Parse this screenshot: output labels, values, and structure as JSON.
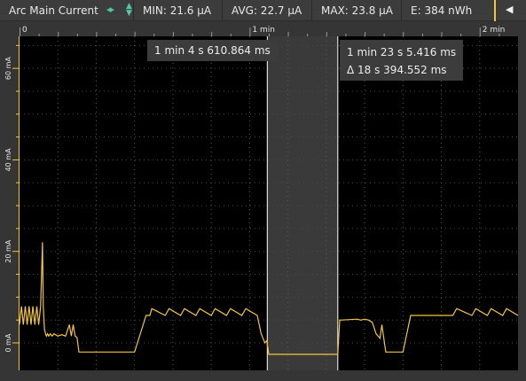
{
  "header": {
    "title": "Arc Main Current",
    "arrows_icon": "pan-arrows-icon",
    "min": "MIN: 21.6 µA",
    "avg": "AVG: 22.7 µA",
    "max": "MAX: 23.8 µA",
    "energy": "E: 384 nWh",
    "collapse_icon": "collapse-left-icon"
  },
  "selection": {
    "start_label": "1 min 4 s 610.864 ms",
    "end_label": "1 min 23 s 5.416 ms",
    "delta_label": "Δ 18 s 394.552 ms"
  },
  "colors": {
    "trace": "#f3c53a",
    "plot_bg": "#000000",
    "panel_bg": "#353535",
    "accent": "#4fc9a6"
  },
  "chart_data": {
    "type": "line",
    "x_ticks": [
      {
        "label": "0",
        "value_s": 0
      },
      {
        "label": "1 min",
        "value_s": 60
      },
      {
        "label": "2 min",
        "value_s": 120
      }
    ],
    "y_ticks": [
      {
        "label": "0 mA",
        "value_ma": 0
      },
      {
        "label": "20 mA",
        "value_ma": 20
      },
      {
        "label": "40 mA",
        "value_ma": 40
      },
      {
        "label": "60 mA",
        "value_ma": 60
      }
    ],
    "xlim_s": [
      0,
      130
    ],
    "ylim_ma": [
      -6,
      67
    ],
    "selection_s": [
      64.61,
      83.005
    ],
    "series": [
      {
        "x": [
          0,
          0.5,
          1.0,
          1.5,
          2.0,
          2.5,
          3.0,
          3.5,
          4.0,
          4.5,
          5.0,
          5.5,
          6.0,
          6.2,
          6.5,
          6.8,
          7.0,
          7.3,
          7.6,
          8.0,
          8.5,
          9.0,
          10,
          11,
          12,
          13,
          13.5,
          14,
          14.5,
          15,
          15.5,
          30,
          33,
          34,
          34.5,
          38,
          39,
          42,
          43,
          46,
          47,
          50,
          51,
          54,
          55,
          58,
          59,
          62,
          63,
          63.5,
          64,
          64.5,
          65,
          70,
          80,
          83,
          83.5,
          84,
          88,
          89,
          90,
          91,
          92,
          93,
          94,
          94.5,
          95,
          95.5,
          96,
          100,
          102,
          113,
          114,
          118,
          119,
          122,
          123,
          126,
          127,
          130
        ],
        "y_ma": [
          4,
          8,
          4,
          8,
          4,
          8,
          4,
          8,
          4,
          8,
          4,
          8,
          22,
          8,
          3,
          2,
          1.5,
          2,
          1.5,
          2,
          1.5,
          2,
          1.5,
          1.8,
          1.5,
          4,
          1.5,
          4,
          1.5,
          1.2,
          -2,
          -2,
          6,
          6,
          7.5,
          6,
          7.5,
          6,
          7.5,
          6,
          7.5,
          6,
          7.5,
          6,
          7.5,
          6,
          7.5,
          6,
          2,
          1,
          0,
          0.5,
          -2.5,
          -2.5,
          -2.5,
          -2.5,
          5,
          5,
          5.2,
          5,
          5.2,
          5,
          4.5,
          2,
          1,
          4,
          1,
          -2,
          -2,
          -2,
          6,
          6,
          7.5,
          6,
          7.5,
          6,
          7.5,
          6,
          7.5,
          6
        ]
      }
    ]
  }
}
